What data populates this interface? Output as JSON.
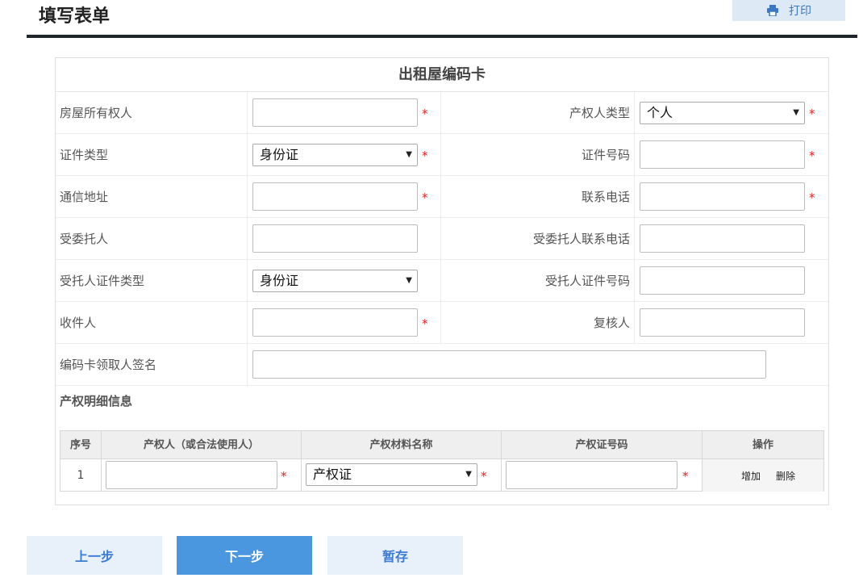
{
  "header": {
    "title": "填写表单",
    "print_label": "打印"
  },
  "card": {
    "title": "出租屋编码卡"
  },
  "fields": {
    "owner": {
      "label": "房屋所有权人",
      "value": ""
    },
    "owner_type": {
      "label": "产权人类型",
      "value": "个人"
    },
    "id_type": {
      "label": "证件类型",
      "value": "身份证"
    },
    "id_number": {
      "label": "证件号码",
      "value": ""
    },
    "address": {
      "label": "通信地址",
      "value": ""
    },
    "phone": {
      "label": "联系电话",
      "value": ""
    },
    "trustee": {
      "label": "受委托人",
      "value": ""
    },
    "trustee_phone": {
      "label": "受委托人联系电话",
      "value": ""
    },
    "trustee_id_type": {
      "label": "受托人证件类型",
      "value": "身份证"
    },
    "trustee_id_number": {
      "label": "受托人证件号码",
      "value": ""
    },
    "receiver": {
      "label": "收件人",
      "value": ""
    },
    "reviewer": {
      "label": "复核人",
      "value": ""
    },
    "card_signer": {
      "label": "编码卡领取人签名",
      "value": ""
    }
  },
  "required_mark": "*",
  "property_section": {
    "title": "产权明细信息",
    "columns": [
      "序号",
      "产权人（或合法使用人）",
      "产权材料名称",
      "产权证号码",
      "操作"
    ],
    "rows": [
      {
        "index": "1",
        "owner": "",
        "material": "产权证",
        "cert_number": "",
        "add_label": "增加",
        "delete_label": "删除"
      }
    ]
  },
  "buttons": {
    "prev": "上一步",
    "next": "下一步",
    "save": "暂存"
  },
  "colors": {
    "accent": "#4a97df",
    "accent_light": "#e8f1fa",
    "required": "#e52020",
    "title_rule": "#20242c"
  },
  "icons": {
    "print": "printer-icon",
    "dropdown": "caret-down-icon"
  }
}
